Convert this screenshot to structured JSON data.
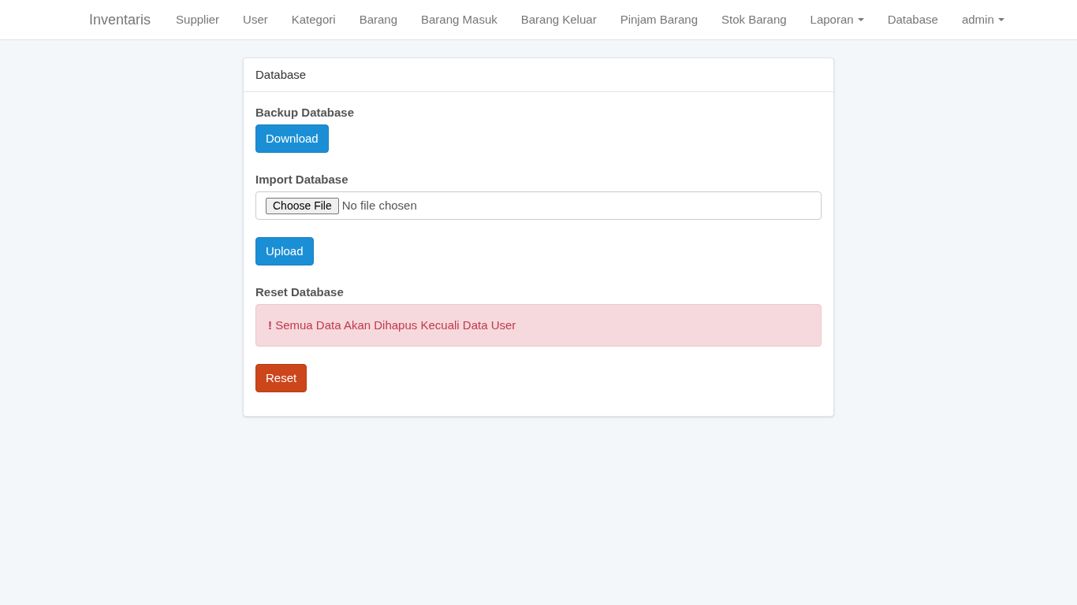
{
  "navbar": {
    "brand": "Inventaris",
    "items": [
      {
        "label": "Supplier",
        "kind": "link"
      },
      {
        "label": "User",
        "kind": "link"
      },
      {
        "label": "Kategori",
        "kind": "link"
      },
      {
        "label": "Barang",
        "kind": "link"
      },
      {
        "label": "Barang Masuk",
        "kind": "link"
      },
      {
        "label": "Barang Keluar",
        "kind": "link"
      },
      {
        "label": "Pinjam Barang",
        "kind": "link"
      },
      {
        "label": "Stok Barang",
        "kind": "link"
      },
      {
        "label": "Laporan",
        "kind": "dropdown"
      },
      {
        "label": "Database",
        "kind": "link"
      },
      {
        "label": "admin",
        "kind": "dropdown"
      }
    ]
  },
  "panel": {
    "title": "Database",
    "sections": [
      {
        "label": "Backup Database",
        "kind": "button",
        "button": {
          "label": "Download"
        }
      },
      {
        "label": "Import Database",
        "kind": "file",
        "choose_label": "Choose File",
        "file_status": "No file chosen",
        "button": {
          "label": "Upload"
        }
      },
      {
        "label": "Reset Database",
        "kind": "alert",
        "alert": "**!** Semua Data Akan Dihapus Kecuali Data User",
        "button": {
          "label": "Reset"
        }
      }
    ]
  }
}
